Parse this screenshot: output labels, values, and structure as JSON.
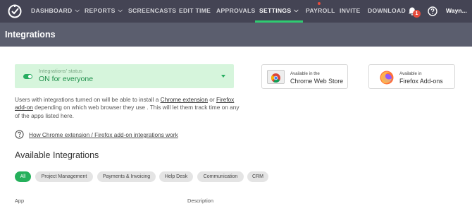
{
  "nav": {
    "items": [
      {
        "label": "DASHBOARD",
        "dropdown": true
      },
      {
        "label": "REPORTS",
        "dropdown": true
      },
      {
        "label": "SCREENCASTS",
        "dropdown": false
      },
      {
        "label": "EDIT TIME",
        "dropdown": false
      },
      {
        "label": "APPROVALS",
        "dropdown": false
      },
      {
        "label": "SETTINGS",
        "dropdown": true,
        "active": true
      },
      {
        "label": "PAYROLL",
        "dropdown": false
      },
      {
        "label": "INVITE",
        "dropdown": false
      },
      {
        "label": "DOWNLOAD",
        "dropdown": false
      }
    ],
    "notification_count": "1",
    "user_name": "Wayn...",
    "icons": [
      "logo-icon",
      "bell-icon",
      "help-circle-icon",
      "chevron-down-icon"
    ]
  },
  "header": {
    "title": "Integrations"
  },
  "status": {
    "label": "Integrations' status",
    "value": "ON for everyone"
  },
  "stores": {
    "chrome": {
      "small": "Available in the",
      "big": "Chrome Web Store"
    },
    "firefox": {
      "small": "Available in",
      "big": "Firefox Add-ons"
    }
  },
  "description": {
    "part1": "Users with integrations turned on will be able to install a ",
    "link1": "Chrome extension",
    "part2": " or ",
    "link2": "Firefox add-on",
    "part3": " depending on which web browser they use . This will let them track time on any of the apps listed here."
  },
  "help_link": "How Chrome extension / Firefox add-on integrations work",
  "section_title": "Available Integrations",
  "filters": [
    "All",
    "Project Management",
    "Payments & Invoicing",
    "Help Desk",
    "Communication",
    "CRM"
  ],
  "table": {
    "columns": [
      "App",
      "Description"
    ]
  },
  "colors": {
    "nav_bg": "#444454",
    "header_bg": "#5b5e6e",
    "accent": "#2ecc71",
    "status_bg": "#d6f5dc",
    "badge": "#e74c3c"
  }
}
